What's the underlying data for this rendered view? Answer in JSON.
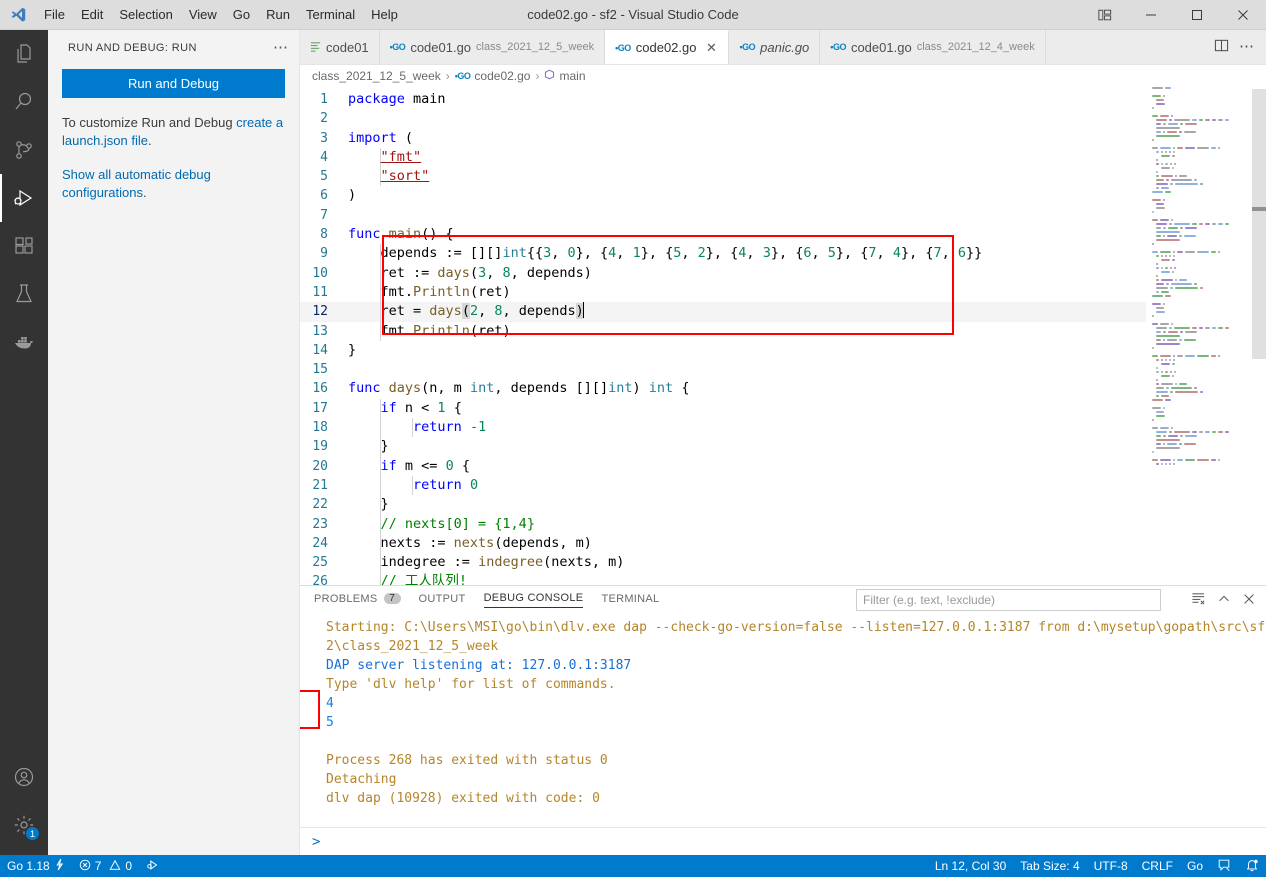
{
  "titlebar": {
    "logo_icon": "vscode-logo",
    "title": "code02.go - sf2 - Visual Studio Code",
    "menus": [
      "File",
      "Edit",
      "Selection",
      "View",
      "Go",
      "Run",
      "Terminal",
      "Help"
    ],
    "controls": [
      {
        "name": "layout-toggle-icon",
        "glyph": "layout"
      },
      {
        "name": "minimize-icon",
        "glyph": "minimize"
      },
      {
        "name": "maximize-icon",
        "glyph": "maximize"
      },
      {
        "name": "close-icon",
        "glyph": "close"
      }
    ]
  },
  "activitybar": {
    "items": [
      {
        "name": "explorer",
        "icon": "files-icon",
        "active": false
      },
      {
        "name": "search",
        "icon": "search-icon",
        "active": false
      },
      {
        "name": "source-control",
        "icon": "source-control-icon",
        "active": false
      },
      {
        "name": "run-and-debug",
        "icon": "run-and-debug-icon",
        "active": true
      },
      {
        "name": "extensions",
        "icon": "extensions-icon",
        "active": false
      },
      {
        "name": "testing",
        "icon": "beaker-icon",
        "active": false
      },
      {
        "name": "docker",
        "icon": "docker-icon",
        "active": false
      }
    ],
    "bottom": [
      {
        "name": "accounts",
        "icon": "account-icon",
        "badge": ""
      },
      {
        "name": "manage-settings",
        "icon": "gear-icon",
        "badge": "1"
      }
    ]
  },
  "sidebar": {
    "header": "RUN AND DEBUG: RUN",
    "more_icon": "ellipsis-icon",
    "run_button": "Run and Debug",
    "paragraph1_pre": "To customize Run and Debug ",
    "paragraph1_link": "create a launch.json file",
    "paragraph1_post": ".",
    "paragraph2_link": "Show all automatic debug configurations",
    "paragraph2_post": "."
  },
  "tabs": [
    {
      "name": "code01",
      "label": "code01",
      "desc": "",
      "icon": "lines-icon",
      "active": false,
      "italic": false,
      "close": false
    },
    {
      "name": "code01.go-12-5",
      "label": "code01.go",
      "desc": "class_2021_12_5_week",
      "icon": "go-icon",
      "active": false,
      "italic": false,
      "close": false
    },
    {
      "name": "code02.go",
      "label": "code02.go",
      "desc": "",
      "icon": "go-icon",
      "active": true,
      "italic": false,
      "close": true
    },
    {
      "name": "panic.go",
      "label": "panic.go",
      "desc": "",
      "icon": "go-icon",
      "active": false,
      "italic": true,
      "close": false
    },
    {
      "name": "code01.go-12-4",
      "label": "code01.go",
      "desc": "class_2021_12_4_week",
      "icon": "go-icon",
      "active": false,
      "italic": false,
      "close": false
    }
  ],
  "tabbar_actions": [
    {
      "name": "split-editor-icon"
    },
    {
      "name": "more-actions-icon"
    }
  ],
  "breadcrumbs": [
    {
      "label": "class_2021_12_5_week",
      "icon": ""
    },
    {
      "label": "code02.go",
      "icon": "go-icon"
    },
    {
      "label": "main",
      "icon": "symbol-method-icon"
    }
  ],
  "editor": {
    "lines": [
      {
        "n": 1,
        "text": "package main"
      },
      {
        "n": 2,
        "text": ""
      },
      {
        "n": 3,
        "text": "import ("
      },
      {
        "n": 4,
        "text": "    \"fmt\""
      },
      {
        "n": 5,
        "text": "    \"sort\""
      },
      {
        "n": 6,
        "text": ")"
      },
      {
        "n": 7,
        "text": ""
      },
      {
        "n": 8,
        "text": "func main() {"
      },
      {
        "n": 9,
        "text": "    depends := [][]int{{3, 0}, {4, 1}, {5, 2}, {4, 3}, {6, 5}, {7, 4}, {7, 6}}"
      },
      {
        "n": 10,
        "text": "    ret := days(3, 8, depends)"
      },
      {
        "n": 11,
        "text": "    fmt.Println(ret)"
      },
      {
        "n": 12,
        "text": "    ret = days(2, 8, depends)"
      },
      {
        "n": 13,
        "text": "    fmt.Println(ret)"
      },
      {
        "n": 14,
        "text": "}"
      },
      {
        "n": 15,
        "text": ""
      },
      {
        "n": 16,
        "text": "func days(n, m int, depends [][]int) int {"
      },
      {
        "n": 17,
        "text": "    if n < 1 {"
      },
      {
        "n": 18,
        "text": "        return -1"
      },
      {
        "n": 19,
        "text": "    }"
      },
      {
        "n": 20,
        "text": "    if m <= 0 {"
      },
      {
        "n": 21,
        "text": "        return 0"
      },
      {
        "n": 22,
        "text": "    }"
      },
      {
        "n": 23,
        "text": "    // nexts[0] = {1,4}"
      },
      {
        "n": 24,
        "text": "    nexts := nexts(depends, m)"
      },
      {
        "n": 25,
        "text": "    indegree := indegree(nexts, m)"
      },
      {
        "n": 26,
        "text": "    // 工人队列!"
      }
    ],
    "current_line": 12,
    "highlight_box_color": "#ff0000"
  },
  "panel": {
    "tabs": [
      {
        "label": "PROBLEMS",
        "count": "7",
        "active": false
      },
      {
        "label": "OUTPUT",
        "count": "",
        "active": false
      },
      {
        "label": "DEBUG CONSOLE",
        "count": "",
        "active": true
      },
      {
        "label": "TERMINAL",
        "count": "",
        "active": false
      }
    ],
    "filter_placeholder": "Filter (e.g. text, !exclude)",
    "filter_value": "",
    "actions": [
      {
        "name": "clear-console-icon"
      },
      {
        "name": "collapse-panel-icon"
      },
      {
        "name": "close-panel-icon"
      }
    ],
    "console_lines": [
      {
        "text": "Starting: C:\\Users\\MSI\\go\\bin\\dlv.exe dap --check-go-version=false --listen=127.0.0.1:3187 from d:\\mysetup\\gopath\\src\\sf",
        "style": "default"
      },
      {
        "text": "2\\class_2021_12_5_week",
        "style": "default"
      },
      {
        "text": "DAP server listening at: 127.0.0.1:3187",
        "style": "blue"
      },
      {
        "text": "Type 'dlv help' for list of commands.",
        "style": "default"
      },
      {
        "text": "4",
        "style": "val"
      },
      {
        "text": "5",
        "style": "val"
      },
      {
        "text": "",
        "style": "default"
      },
      {
        "text": "Process 268 has exited with status 0",
        "style": "default"
      },
      {
        "text": "Detaching",
        "style": "default"
      },
      {
        "text": "dlv dap (10928) exited with code: 0",
        "style": "default"
      }
    ],
    "repl_prompt": ">",
    "repl_value": "",
    "highlight_box_color": "#ff0000"
  },
  "statusbar": {
    "left": [
      {
        "name": "go-version",
        "label": "Go 1.18",
        "icon": "lightning-icon"
      },
      {
        "name": "problems",
        "label": "7",
        "icon": "error-icon",
        "label2": "0",
        "icon2": "warning-icon"
      },
      {
        "name": "go-run",
        "label": "",
        "icon": "debug-start-icon"
      }
    ],
    "right": [
      {
        "name": "cursor-position",
        "label": "Ln 12, Col 30"
      },
      {
        "name": "tab-size",
        "label": "Tab Size: 4"
      },
      {
        "name": "encoding",
        "label": "UTF-8"
      },
      {
        "name": "eol",
        "label": "CRLF"
      },
      {
        "name": "language-mode",
        "label": "Go"
      },
      {
        "name": "feedback",
        "label": "",
        "icon": "feedback-icon"
      },
      {
        "name": "notifications",
        "label": "",
        "icon": "bell-dot-icon"
      }
    ]
  },
  "colors": {
    "accent": "#007acc",
    "titlebar_bg": "#dddddd",
    "sidebar_bg": "#f3f3f3",
    "activitybar_bg": "#333333",
    "highlight_red": "#ff0000"
  }
}
